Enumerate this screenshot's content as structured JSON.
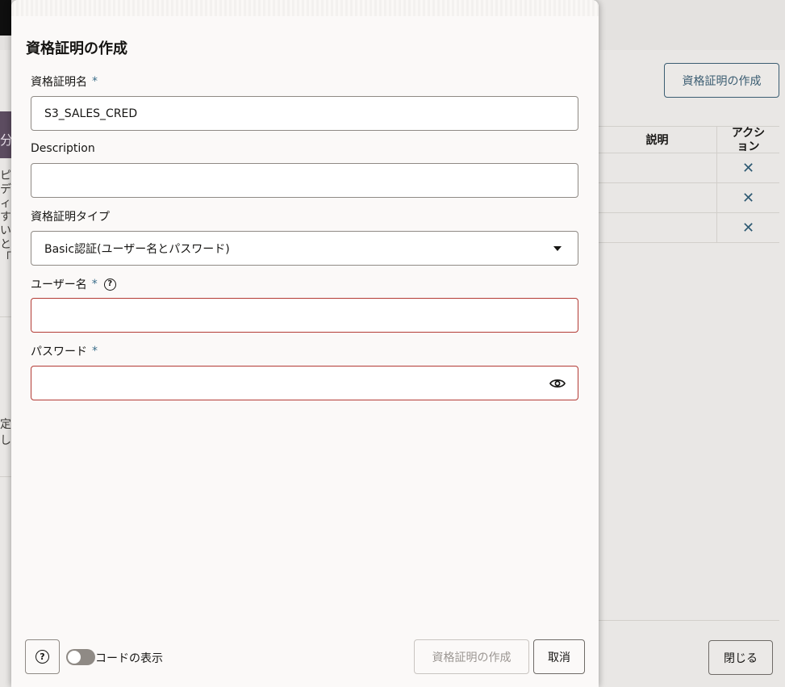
{
  "background": {
    "create_button_label": "資格証明の作成",
    "table": {
      "columns": [
        "説明",
        "アクション"
      ],
      "rows": 3,
      "row_action_icon": "close-x-icon"
    },
    "side_purple_text": "分",
    "side_text": "ピディすい・と「て",
    "side_text_2": "定し",
    "close_button_label": "閉じる"
  },
  "dialog": {
    "title": "資格証明の作成",
    "fields": {
      "credential_name": {
        "label": "資格証明名",
        "required_mark": "*",
        "value": "S3_SALES_CRED"
      },
      "description": {
        "label": "Description",
        "value": ""
      },
      "credential_type": {
        "label": "資格証明タイプ",
        "selected": "Basic認証(ユーザー名とパスワード)"
      },
      "username": {
        "label": "ユーザー名",
        "required_mark": "*",
        "help_icon": "help-icon",
        "value": ""
      },
      "password": {
        "label": "パスワード",
        "required_mark": "*",
        "value": "",
        "reveal_icon": "eye-icon"
      }
    },
    "footer": {
      "help_icon": "help-icon",
      "show_code_label": "コードの表示",
      "show_code_on": false,
      "create_button_label": "資格証明の作成",
      "cancel_button_label": "取消"
    }
  },
  "colors": {
    "accent": "#3b5d72",
    "required": "#3b6e8a",
    "invalid_border": "#b33b35",
    "drawer_bg": "#fbf9f8"
  }
}
